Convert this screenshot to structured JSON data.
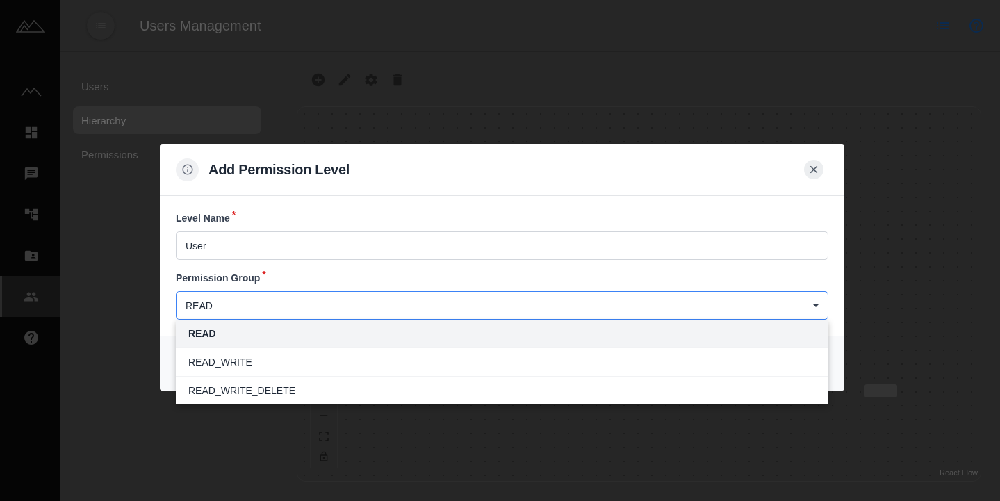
{
  "header": {
    "title": "Users Management"
  },
  "rail": [
    {
      "kind": "mountain",
      "selected": false
    },
    {
      "kind": "dashboard",
      "selected": false
    },
    {
      "kind": "chat",
      "selected": false
    },
    {
      "kind": "tree",
      "selected": false
    },
    {
      "kind": "folder",
      "selected": false
    },
    {
      "kind": "people",
      "selected": true
    },
    {
      "kind": "help",
      "selected": false
    }
  ],
  "subnav": [
    {
      "label": "Users",
      "selected": false
    },
    {
      "label": "Hierarchy",
      "selected": true
    },
    {
      "label": "Permissions",
      "selected": false
    }
  ],
  "canvas": {
    "attribution": "React Flow"
  },
  "dialog": {
    "title": "Add Permission Level",
    "fields": [
      {
        "label": "Level Name",
        "mark": "*",
        "value": "User"
      },
      {
        "label": "Permission Group",
        "mark": "*",
        "value": "READ"
      }
    ],
    "options": [
      {
        "label": "READ",
        "selected": true
      },
      {
        "label": "READ_WRITE",
        "selected": false
      },
      {
        "label": "READ_WRITE_DELETE",
        "selected": false
      }
    ]
  }
}
